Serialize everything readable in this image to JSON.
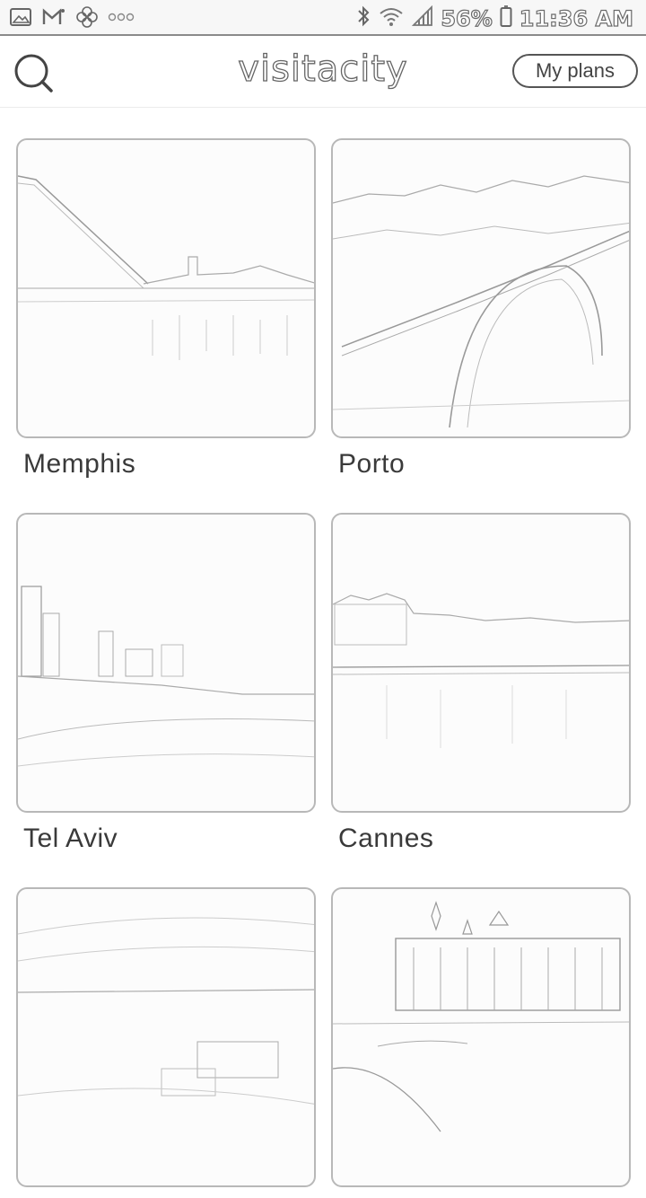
{
  "status_bar": {
    "battery": "56%",
    "time": "11:36 AM",
    "left_icons": [
      "gallery-icon",
      "gmail-icon",
      "pinwheel-icon",
      "more-dots-icon"
    ],
    "right_icons": [
      "bluetooth-icon",
      "wifi-icon",
      "signal-icon",
      "battery-icon"
    ]
  },
  "header": {
    "logo": "visitacity",
    "my_plans_label": "My plans",
    "search_icon": "search-icon"
  },
  "cities": [
    {
      "name": "Memphis"
    },
    {
      "name": "Porto"
    },
    {
      "name": "Tel Aviv"
    },
    {
      "name": "Cannes"
    },
    {
      "name": ""
    },
    {
      "name": ""
    }
  ]
}
